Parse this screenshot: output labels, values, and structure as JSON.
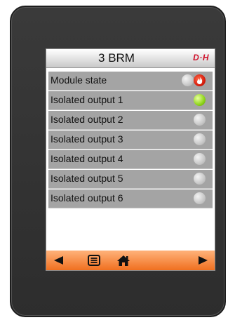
{
  "header": {
    "title": "3 BRM",
    "logo": "D·H"
  },
  "rows": [
    {
      "label": "Module state",
      "status": "alarm"
    },
    {
      "label": "Isolated output 1",
      "status": "green"
    },
    {
      "label": "Isolated output 2",
      "status": "off"
    },
    {
      "label": "Isolated output 3",
      "status": "off"
    },
    {
      "label": "Isolated output 4",
      "status": "off"
    },
    {
      "label": "Isolated output 5",
      "status": "off"
    },
    {
      "label": "Isolated output 6",
      "status": "off"
    }
  ],
  "footer": {
    "icons": [
      "arrow-left-icon",
      "list-icon",
      "home-icon",
      "arrow-right-icon"
    ]
  },
  "colors": {
    "footer_accent": "#f07020",
    "row_background": "#a4a4a4",
    "led_green": "#8ed41a",
    "led_alarm": "#d91f0e",
    "logo": "#d0102a"
  }
}
